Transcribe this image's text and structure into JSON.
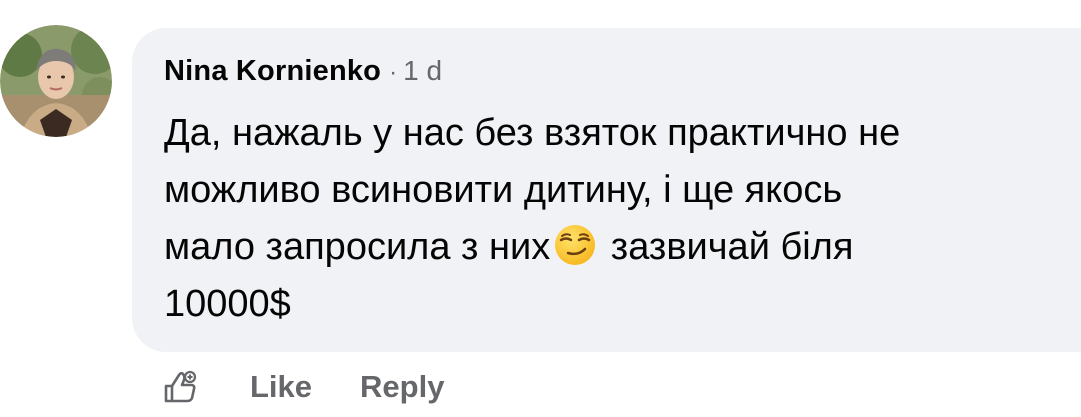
{
  "comment": {
    "author": "Nina  Kornienko",
    "separator": "·",
    "time": "1 d",
    "text_lines": [
      "Да, нажаль у нас без взяток практично не",
      "можливо всиновити дитину, і ще якось",
      "мало запросила з них",
      "зазвичай біля",
      "10000$"
    ],
    "emoji": "smirking-face"
  },
  "actions": {
    "like_label": "Like",
    "reply_label": "Reply"
  },
  "colors": {
    "bubble": "#f0f2f5",
    "text": "#050505",
    "secondary": "#65676b"
  }
}
